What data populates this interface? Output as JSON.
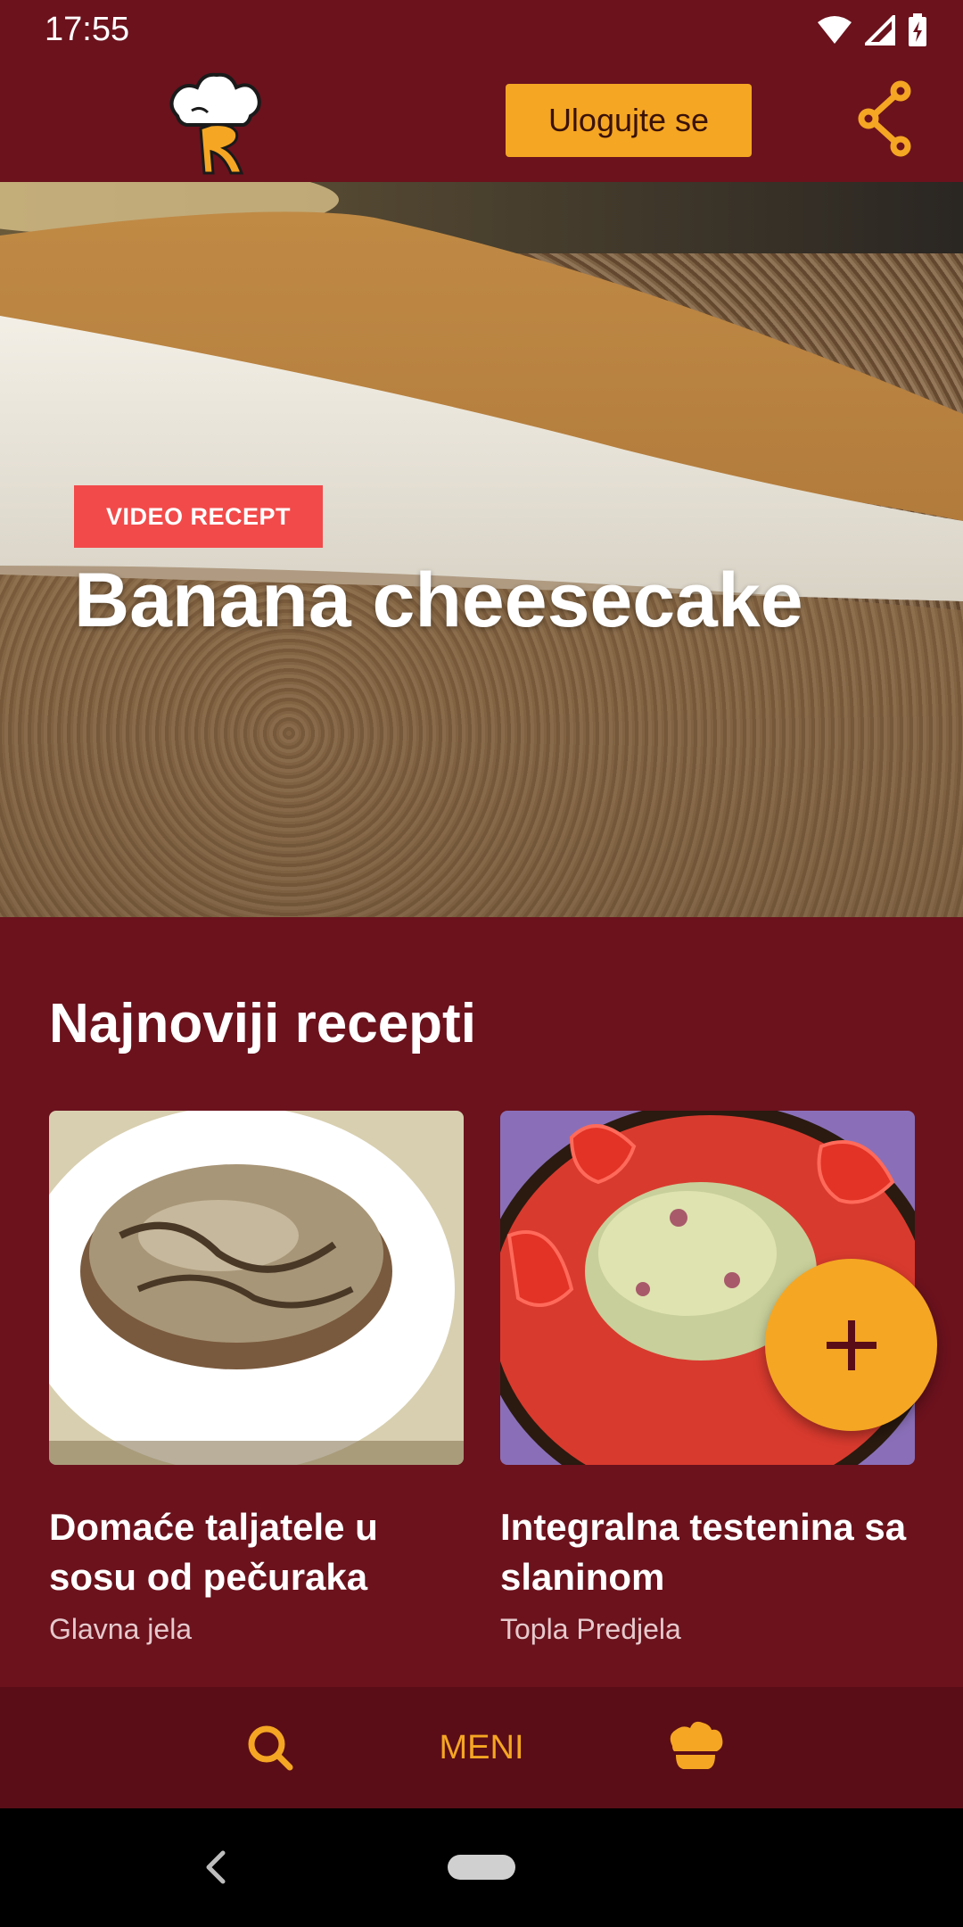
{
  "status_bar": {
    "time": "17:55"
  },
  "app_bar": {
    "login_label": "Ulogujte se"
  },
  "hero": {
    "badge": "VIDEO RECEPT",
    "title": "Banana cheesecake"
  },
  "latest": {
    "section_title": "Najnoviji recepti",
    "recipes": [
      {
        "title": "Domaće taljatele u sosu od pečuraka",
        "category": "Glavna jela"
      },
      {
        "title": "Integralna testenina sa slaninom",
        "category": "Topla Predjela"
      }
    ]
  },
  "bottom_nav": {
    "menu_label": "MENI"
  },
  "colors": {
    "background": "#6b121d",
    "accent": "#f5a623",
    "badge": "#f24a4a",
    "bottom_nav": "#5a0d16"
  },
  "icons": [
    "wifi-icon",
    "signal-icon",
    "battery-icon",
    "chef-hat-logo",
    "share-icon",
    "plus-icon",
    "search-icon",
    "chef-hat-icon",
    "back-icon"
  ]
}
